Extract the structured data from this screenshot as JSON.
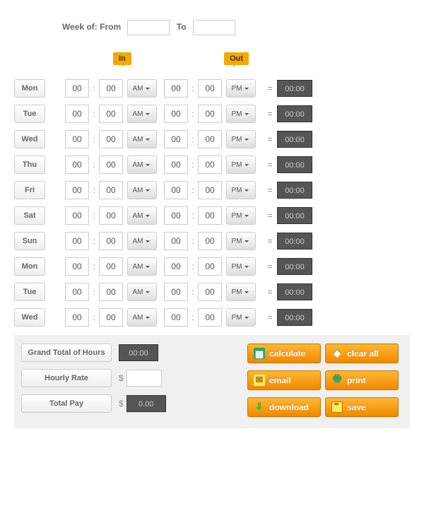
{
  "week": {
    "label_prefix": "Week of: From",
    "label_to": "To",
    "from": "",
    "to": ""
  },
  "inout": {
    "in": "In",
    "out": "Out"
  },
  "days": [
    {
      "name": "Mon",
      "ih": "00",
      "im": "00",
      "ip": "AM",
      "oh": "00",
      "om": "00",
      "op": "PM",
      "total": "00:00"
    },
    {
      "name": "Tue",
      "ih": "00",
      "im": "00",
      "ip": "AM",
      "oh": "00",
      "om": "00",
      "op": "PM",
      "total": "00:00"
    },
    {
      "name": "Wed",
      "ih": "00",
      "im": "00",
      "ip": "AM",
      "oh": "00",
      "om": "00",
      "op": "PM",
      "total": "00:00"
    },
    {
      "name": "Thu",
      "ih": "00",
      "im": "00",
      "ip": "AM",
      "oh": "00",
      "om": "00",
      "op": "PM",
      "total": "00:00"
    },
    {
      "name": "Fri",
      "ih": "00",
      "im": "00",
      "ip": "AM",
      "oh": "00",
      "om": "00",
      "op": "PM",
      "total": "00:00"
    },
    {
      "name": "Sat",
      "ih": "00",
      "im": "00",
      "ip": "AM",
      "oh": "00",
      "om": "00",
      "op": "PM",
      "total": "00:00"
    },
    {
      "name": "Sun",
      "ih": "00",
      "im": "00",
      "ip": "AM",
      "oh": "00",
      "om": "00",
      "op": "PM",
      "total": "00:00"
    },
    {
      "name": "Mon",
      "ih": "00",
      "im": "00",
      "ip": "AM",
      "oh": "00",
      "om": "00",
      "op": "PM",
      "total": "00:00"
    },
    {
      "name": "Tue",
      "ih": "00",
      "im": "00",
      "ip": "AM",
      "oh": "00",
      "om": "00",
      "op": "PM",
      "total": "00:00"
    },
    {
      "name": "Wed",
      "ih": "00",
      "im": "00",
      "ip": "AM",
      "oh": "00",
      "om": "00",
      "op": "PM",
      "total": "00:00"
    }
  ],
  "symbols": {
    "colon": ":",
    "equals": "=",
    "dollar": "$"
  },
  "footer": {
    "grand_total_label": "Grand Total of Hours",
    "grand_total": "00:00",
    "hourly_rate_label": "Hourly Rate",
    "hourly_rate": "",
    "total_pay_label": "Total Pay",
    "total_pay": "0.00"
  },
  "buttons": {
    "calculate": "calculate",
    "clear_all": "clear all",
    "email": "email",
    "print": "print",
    "download": "download",
    "save": "save"
  }
}
